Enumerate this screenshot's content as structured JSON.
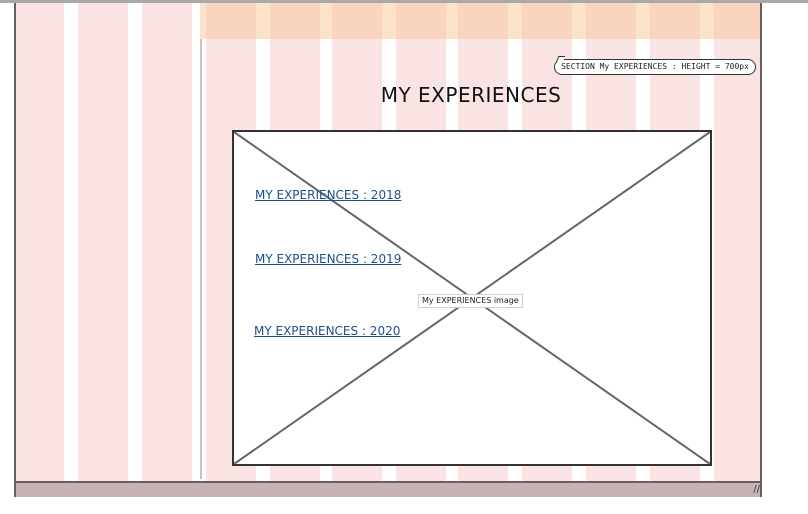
{
  "annotation": {
    "text": "SECTION My EXPERIENCES : HEIGHT = 700px"
  },
  "section": {
    "title": "MY EXPERIENCES"
  },
  "image": {
    "label": "My EXPERIENCES image"
  },
  "links": [
    {
      "label": "MY EXPERIENCES : 2018"
    },
    {
      "label": "MY EXPERIENCES : 2019"
    },
    {
      "label": "MY EXPERIENCES : 2020"
    }
  ],
  "colors": {
    "grid_column": "#f9e3e3",
    "top_band": "#fbd2b0",
    "link": "#1f4e8a",
    "bottom_bar": "#c7b3b3"
  }
}
